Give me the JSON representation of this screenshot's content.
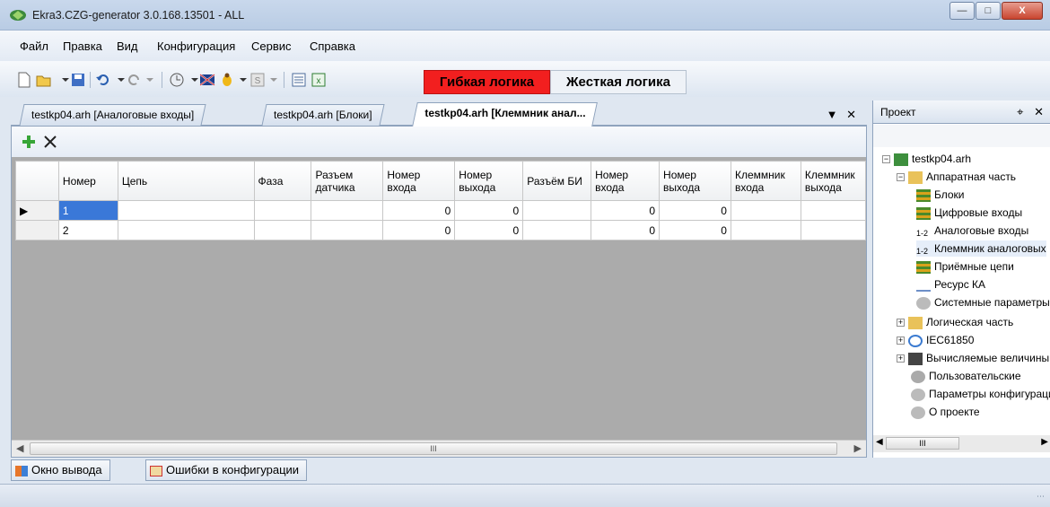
{
  "window": {
    "title": "Ekra3.CZG-generator 3.0.168.13501 - ALL"
  },
  "menu": [
    "Файл",
    "Правка",
    "Вид",
    "Конфигурация",
    "Сервис",
    "Справка"
  ],
  "logic_buttons": {
    "flexible": "Гибкая логика",
    "hard": "Жесткая логика"
  },
  "doc_tabs": [
    {
      "label": "testkp04.arh [Аналоговые входы]"
    },
    {
      "label": "testkp04.arh [Блоки]"
    },
    {
      "label": "testkp04.arh [Клеммник анал..."
    }
  ],
  "grid": {
    "columns": [
      "Номер",
      "Цепь",
      "Фаза",
      "Разъем датчика",
      "Номер входа",
      "Номер выхода",
      "Разъём БИ",
      "Номер входа",
      "Номер выхода",
      "Клеммник входа",
      "Клеммник выхода"
    ],
    "rows": [
      [
        "1",
        "",
        "",
        "",
        "0",
        "0",
        "",
        "0",
        "0",
        "",
        ""
      ],
      [
        "2",
        "",
        "",
        "",
        "0",
        "0",
        "",
        "0",
        "0",
        "",
        ""
      ]
    ],
    "hscroll_label": "III"
  },
  "project": {
    "title": "Проект",
    "tree": [
      {
        "label": "testkp04.arh",
        "icon": "project-icon"
      },
      {
        "label": "Аппаратная часть",
        "icon": "folder-open-icon"
      },
      {
        "label": "Блоки",
        "icon": "blocks-icon"
      },
      {
        "label": "Цифровые входы",
        "icon": "digital-inputs-icon"
      },
      {
        "label": "Аналоговые входы",
        "icon": "analog-inputs-icon"
      },
      {
        "label": "Клеммник аналоговых",
        "icon": "terminal-icon"
      },
      {
        "label": "Приёмные цепи",
        "icon": "receive-circuits-icon"
      },
      {
        "label": "Ресурс КА",
        "icon": "resource-icon"
      },
      {
        "label": "Системные параметры",
        "icon": "gear-icon"
      },
      {
        "label": "Логическая часть",
        "icon": "folder-icon"
      },
      {
        "label": "IEC61850",
        "icon": "network-icon"
      },
      {
        "label": "Вычисляемые величины",
        "icon": "calculator-icon"
      },
      {
        "label": "Пользовательские",
        "icon": "user-gear-icon"
      },
      {
        "label": "Параметры конфигурации",
        "icon": "gear-icon"
      },
      {
        "label": "О проекте",
        "icon": "gear-icon"
      }
    ],
    "scroll_label": "III"
  },
  "bottom_tabs": [
    {
      "label": "Окно вывода"
    },
    {
      "label": "Ошибки в конфигурации"
    }
  ],
  "colors": {
    "flexible_logic_bg": "#f21f1f",
    "selection": "#3a78d8"
  }
}
